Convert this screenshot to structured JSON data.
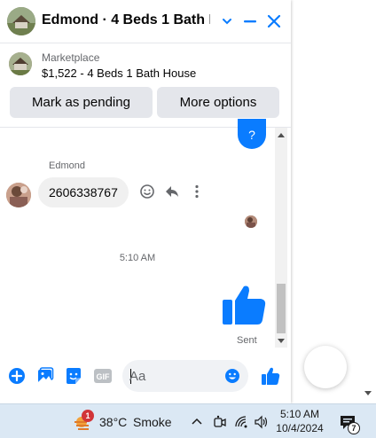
{
  "chat": {
    "title": "Edmond · 4 Beds 1 Bath H...",
    "accent": "#0a7cff"
  },
  "marketplace": {
    "label": "Marketplace",
    "listing": "$1,522 - 4 Beds 1 Bath House",
    "mark_pending": "Mark as pending",
    "more_options": "More options"
  },
  "messages": {
    "prev_bubble": "?",
    "sender": "Edmond",
    "incoming_text": "2606338767",
    "timestamp": "5:10 AM",
    "sent_status": "Sent"
  },
  "composer": {
    "placeholder": "Aa",
    "gif_label": "GIF"
  },
  "taskbar": {
    "weather_badge": "1",
    "temperature": "38°C",
    "weather_condition": "Smoke",
    "time": "5:10 AM",
    "date": "10/4/2024",
    "notification_count": "7"
  }
}
